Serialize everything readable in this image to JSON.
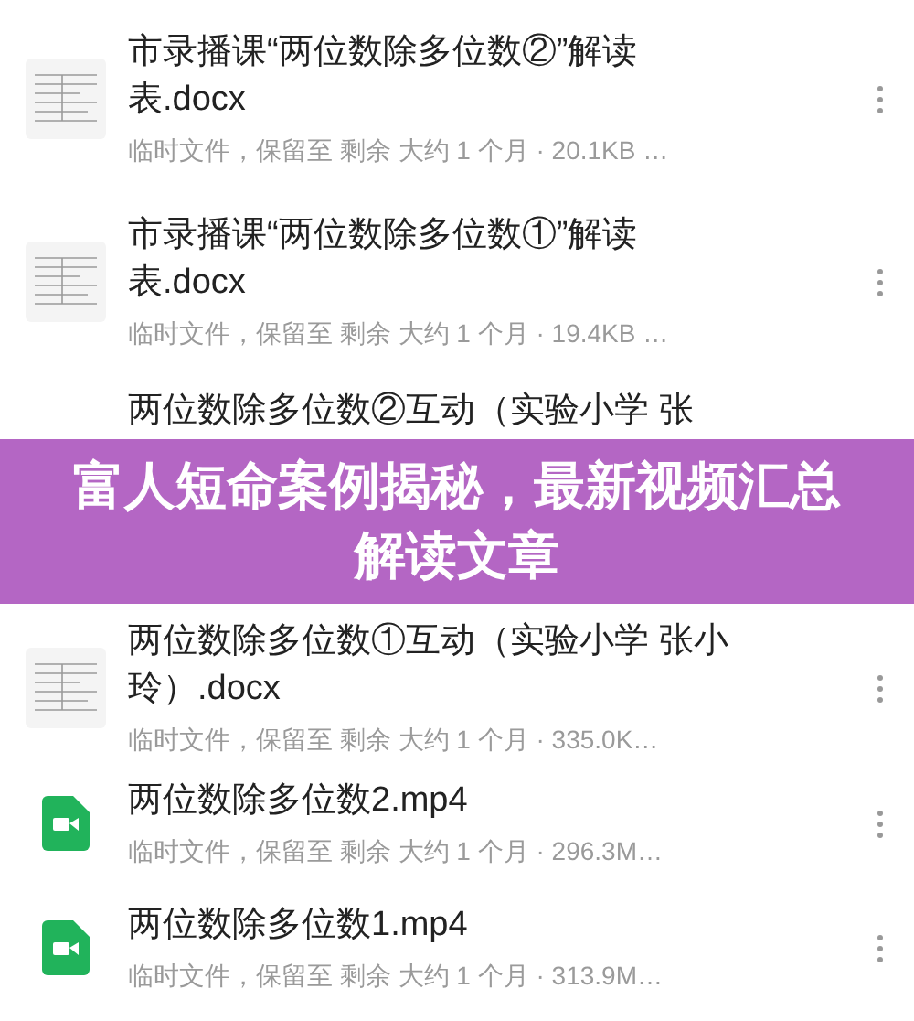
{
  "files": [
    {
      "kind": "document",
      "title": "市录播课“两位数除多位数②”解读表.docx",
      "meta": "临时文件，保留至 剩余 大约 1 个月 · 20.1KB …"
    },
    {
      "kind": "document",
      "title": "市录播课“两位数除多位数①”解读表.docx",
      "meta": "临时文件，保留至 剩余 大约 1 个月 · 19.4KB …"
    },
    {
      "title": "两位数除多位数②互动（实验小学 张"
    },
    {
      "kind": "document",
      "title": "两位数除多位数①互动（实验小学 张小玲）.docx",
      "meta": "临时文件，保留至 剩余 大约 1 个月 · 335.0K…"
    },
    {
      "kind": "video",
      "title": "两位数除多位数2.mp4",
      "meta": "临时文件，保留至 剩余 大约 1 个月 · 296.3M…"
    },
    {
      "kind": "video",
      "title": "两位数除多位数1.mp4",
      "meta": "临时文件，保留至 剩余 大约 1 个月 · 313.9M…"
    }
  ],
  "overlay_banner": {
    "text": "富人短命案例揭秘，最新视频汇总解读文章"
  }
}
